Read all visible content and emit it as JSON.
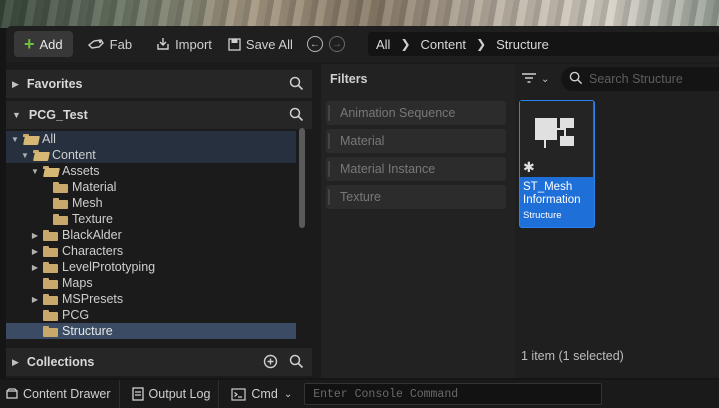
{
  "toolbar": {
    "add_label": "Add",
    "fab_label": "Fab",
    "import_label": "Import",
    "save_all_label": "Save All"
  },
  "breadcrumb": [
    "All",
    "Content",
    "Structure"
  ],
  "sections": {
    "favorites": "Favorites",
    "project": "PCG_Test",
    "collections": "Collections"
  },
  "tree": {
    "all": "All",
    "content": "Content",
    "assets": "Assets",
    "material": "Material",
    "mesh": "Mesh",
    "texture": "Texture",
    "blackalder": "BlackAlder",
    "characters": "Characters",
    "levelprototyping": "LevelPrototyping",
    "maps": "Maps",
    "mspresets": "MSPresets",
    "pcg": "PCG",
    "structure": "Structure"
  },
  "filters": {
    "title": "Filters",
    "items": [
      "Animation Sequence",
      "Material",
      "Material Instance",
      "Texture"
    ]
  },
  "search": {
    "placeholder": "Search Structure"
  },
  "asset": {
    "name": "ST_Mesh Information",
    "type": "Structure"
  },
  "status": {
    "item_count": "1 item (1 selected)"
  },
  "bottom": {
    "content_drawer": "Content Drawer",
    "output_log": "Output Log",
    "cmd": "Cmd",
    "console_placeholder": "Enter Console Command"
  },
  "colors": {
    "accent_green": "#6fbf3f",
    "selection_blue": "#1f6fd8",
    "folder": "#c9a96b"
  }
}
